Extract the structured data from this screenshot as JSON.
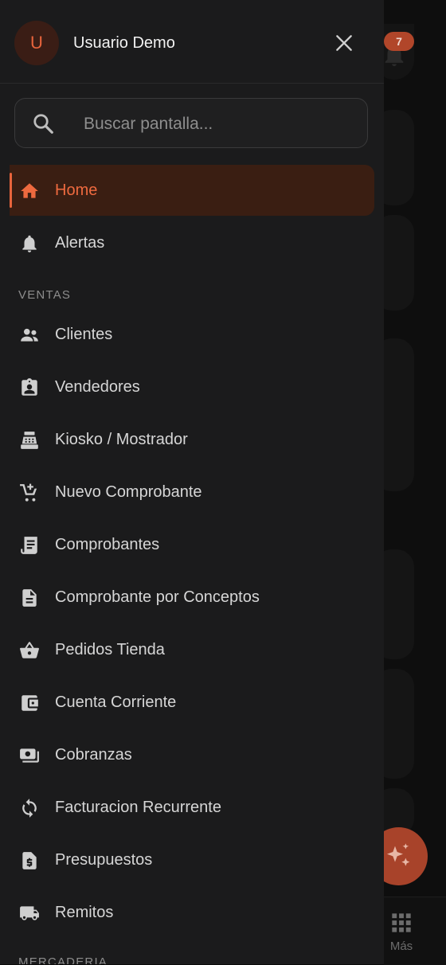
{
  "user": {
    "initial": "U",
    "name": "Usuario Demo"
  },
  "search": {
    "placeholder": "Buscar pantalla..."
  },
  "nav_top": [
    {
      "label": "Home",
      "icon": "home-icon",
      "active": true
    },
    {
      "label": "Alertas",
      "icon": "bell-icon",
      "active": false
    }
  ],
  "sections": [
    {
      "title": "VENTAS",
      "items": [
        {
          "label": "Clientes",
          "icon": "people-icon"
        },
        {
          "label": "Vendedores",
          "icon": "badge-icon"
        },
        {
          "label": "Kiosko / Mostrador",
          "icon": "cash-register-icon"
        },
        {
          "label": "Nuevo Comprobante",
          "icon": "add-cart-icon"
        },
        {
          "label": "Comprobantes",
          "icon": "receipt-icon"
        },
        {
          "label": "Comprobante por Conceptos",
          "icon": "document-icon"
        },
        {
          "label": "Pedidos Tienda",
          "icon": "basket-icon"
        },
        {
          "label": "Cuenta Corriente",
          "icon": "wallet-icon"
        },
        {
          "label": "Cobranzas",
          "icon": "payments-icon"
        },
        {
          "label": "Facturacion Recurrente",
          "icon": "sync-icon"
        },
        {
          "label": "Presupuestos",
          "icon": "quote-icon"
        },
        {
          "label": "Remitos",
          "icon": "truck-icon"
        }
      ]
    },
    {
      "title": "MERCADERIA",
      "items": []
    }
  ],
  "background": {
    "notification_count": "7",
    "more_label": "Más"
  },
  "colors": {
    "accent": "#e8643c",
    "active_bg": "#3a1e12",
    "drawer_bg": "#1b1b1c"
  }
}
